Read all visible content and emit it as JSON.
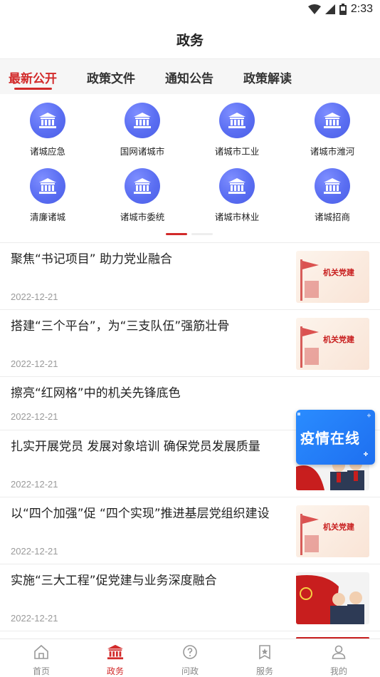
{
  "status_bar": {
    "time": "2:33",
    "icons": [
      "wifi-icon",
      "signal-icon",
      "battery-icon"
    ]
  },
  "header": {
    "title": "政务"
  },
  "tabs": [
    {
      "label": "最新公开",
      "active": true
    },
    {
      "label": "政策文件",
      "active": false
    },
    {
      "label": "通知公告",
      "active": false
    },
    {
      "label": "政策解读",
      "active": false
    }
  ],
  "channels": [
    {
      "label": "诸城应急",
      "icon": "government-building-icon"
    },
    {
      "label": "国网诸城市",
      "icon": "government-building-icon"
    },
    {
      "label": "诸城市工业",
      "icon": "government-building-icon"
    },
    {
      "label": "诸城市潍河",
      "icon": "government-building-icon"
    },
    {
      "label": "清廉诸城",
      "icon": "government-building-icon"
    },
    {
      "label": "诸城市委统",
      "icon": "government-building-icon"
    },
    {
      "label": "诸城市林业",
      "icon": "government-building-icon"
    },
    {
      "label": "诸城招商",
      "icon": "government-building-icon"
    }
  ],
  "news": [
    {
      "title": "聚焦“书记项目” 助力党业融合",
      "date": "2022-12-21",
      "thumb": "机关党建"
    },
    {
      "title": "搭建“三个平台”，为“三支队伍”强筋壮骨",
      "date": "2022-12-21",
      "thumb": "机关党建"
    },
    {
      "title": "擦亮“红网格”中的机关先锋底色",
      "date": "2022-12-21",
      "thumb": ""
    },
    {
      "title": "扎实开展党员  发展对象培训  确保党员发展质量",
      "date": "2022-12-21",
      "thumb": ""
    },
    {
      "title": "以“四个加强”促 “四个实现”推进基层党组织建设",
      "date": "2022-12-21",
      "thumb": "机关党建"
    },
    {
      "title": "实施“三大工程”促党建与业务深度融合",
      "date": "2022-12-21",
      "thumb": ""
    }
  ],
  "float_ad": {
    "label": "疫情在线"
  },
  "bottom_nav": [
    {
      "label": "首页",
      "icon": "home-icon",
      "active": false
    },
    {
      "label": "政务",
      "icon": "government-building-icon",
      "active": true
    },
    {
      "label": "问政",
      "icon": "question-icon",
      "active": false
    },
    {
      "label": "服务",
      "icon": "service-star-icon",
      "active": false
    },
    {
      "label": "我的",
      "icon": "user-icon",
      "active": false
    }
  ],
  "colors": {
    "accent": "#d22a2a",
    "icon_blue": "#5a6ef2",
    "ad_blue": "#1e6ff0"
  }
}
